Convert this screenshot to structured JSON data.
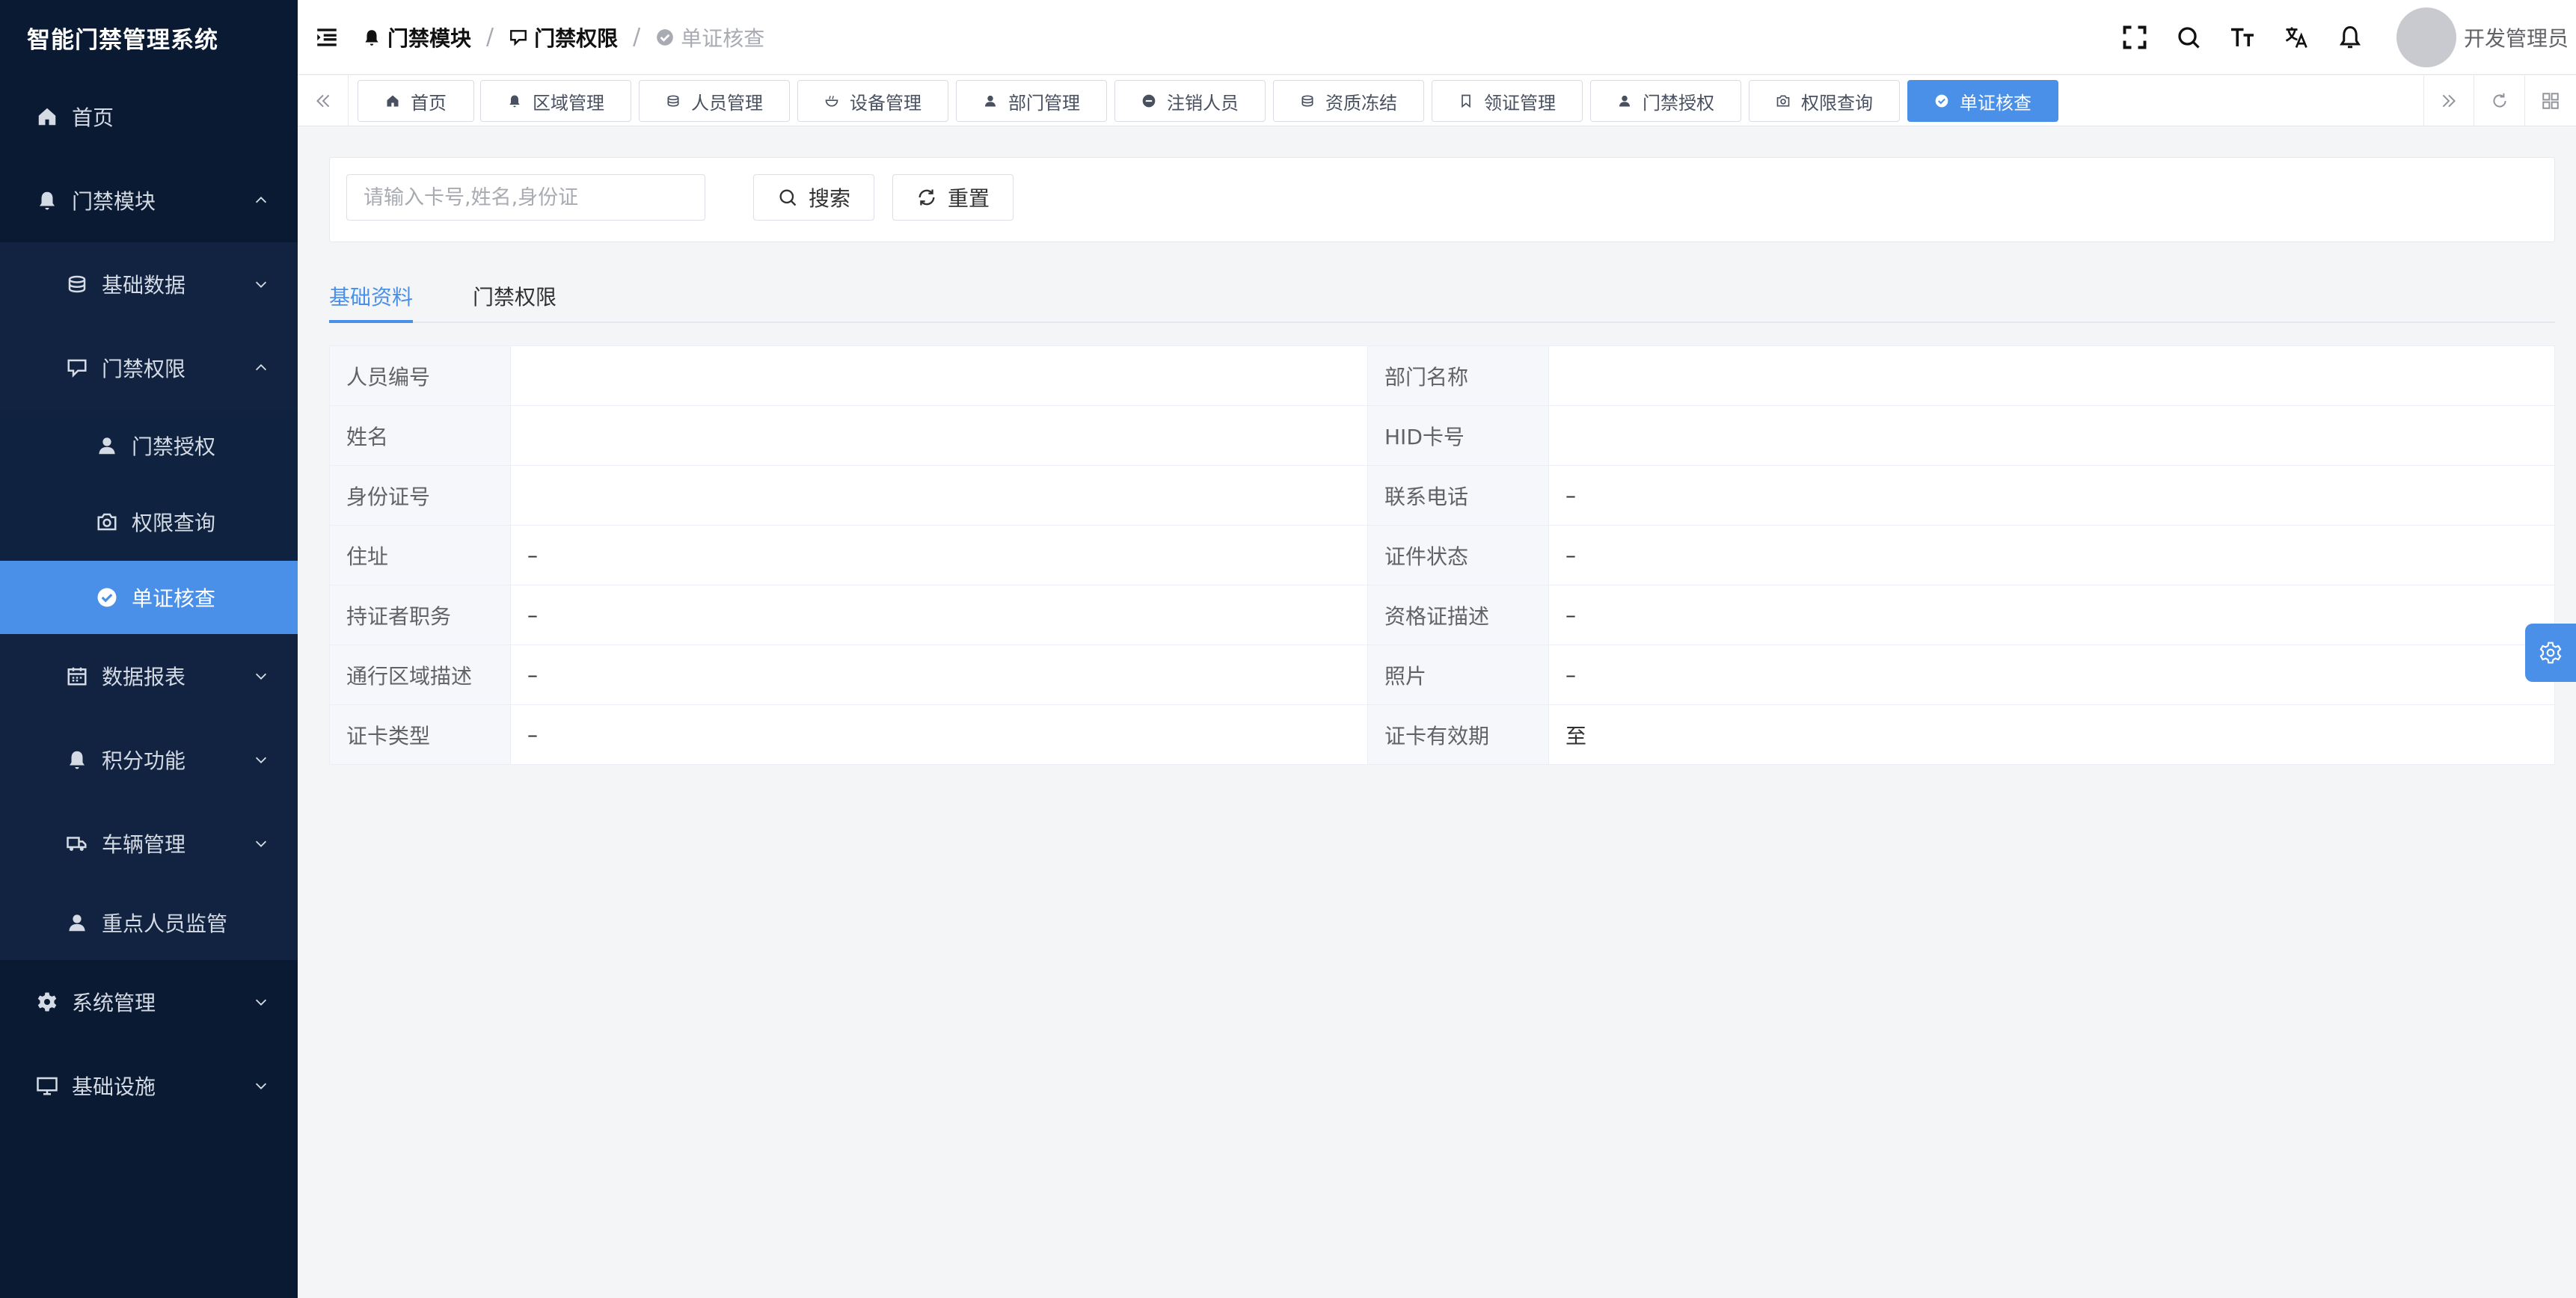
{
  "app": {
    "title": "智能门禁管理系统"
  },
  "sidebar": {
    "home": "首页",
    "access_module": "门禁模块",
    "basic_data": "基础数据",
    "access_permission": "门禁权限",
    "access_authorization": "门禁授权",
    "permission_query": "权限查询",
    "single_card_check": "单证核查",
    "data_report": "数据报表",
    "points": "积分功能",
    "vehicle": "车辆管理",
    "key_person": "重点人员监管",
    "system": "系统管理",
    "infrastructure": "基础设施"
  },
  "breadcrumb": {
    "items": [
      "门禁模块",
      "门禁权限",
      "单证核查"
    ],
    "sep": "/"
  },
  "header": {
    "user_name": "开发管理员"
  },
  "tags": [
    "首页",
    "区域管理",
    "人员管理",
    "设备管理",
    "部门管理",
    "注销人员",
    "资质冻结",
    "领证管理",
    "门禁授权",
    "权限查询",
    "单证核查"
  ],
  "search": {
    "placeholder": "请输入卡号,姓名,身份证",
    "value": "",
    "search_label": "搜索",
    "reset_label": "重置"
  },
  "tabs": [
    "基础资料",
    "门禁权限"
  ],
  "details": {
    "rows": [
      [
        {
          "label": "人员编号",
          "value": ""
        },
        {
          "label": "部门名称",
          "value": ""
        }
      ],
      [
        {
          "label": "姓名",
          "value": ""
        },
        {
          "label": "HID卡号",
          "value": ""
        }
      ],
      [
        {
          "label": "身份证号",
          "value": ""
        },
        {
          "label": "联系电话",
          "value": "–"
        }
      ],
      [
        {
          "label": "住址",
          "value": "–"
        },
        {
          "label": "证件状态",
          "value": "–"
        }
      ],
      [
        {
          "label": "持证者职务",
          "value": "–"
        },
        {
          "label": "资格证描述",
          "value": "–"
        }
      ],
      [
        {
          "label": "通行区域描述",
          "value": "–"
        },
        {
          "label": "照片",
          "value": "–"
        }
      ],
      [
        {
          "label": "证卡类型",
          "value": "–"
        },
        {
          "label": "证卡有效期",
          "value": "至"
        }
      ]
    ]
  },
  "colors": {
    "sidebar_bg": "#0a1a33",
    "accent": "#4a90e8"
  }
}
